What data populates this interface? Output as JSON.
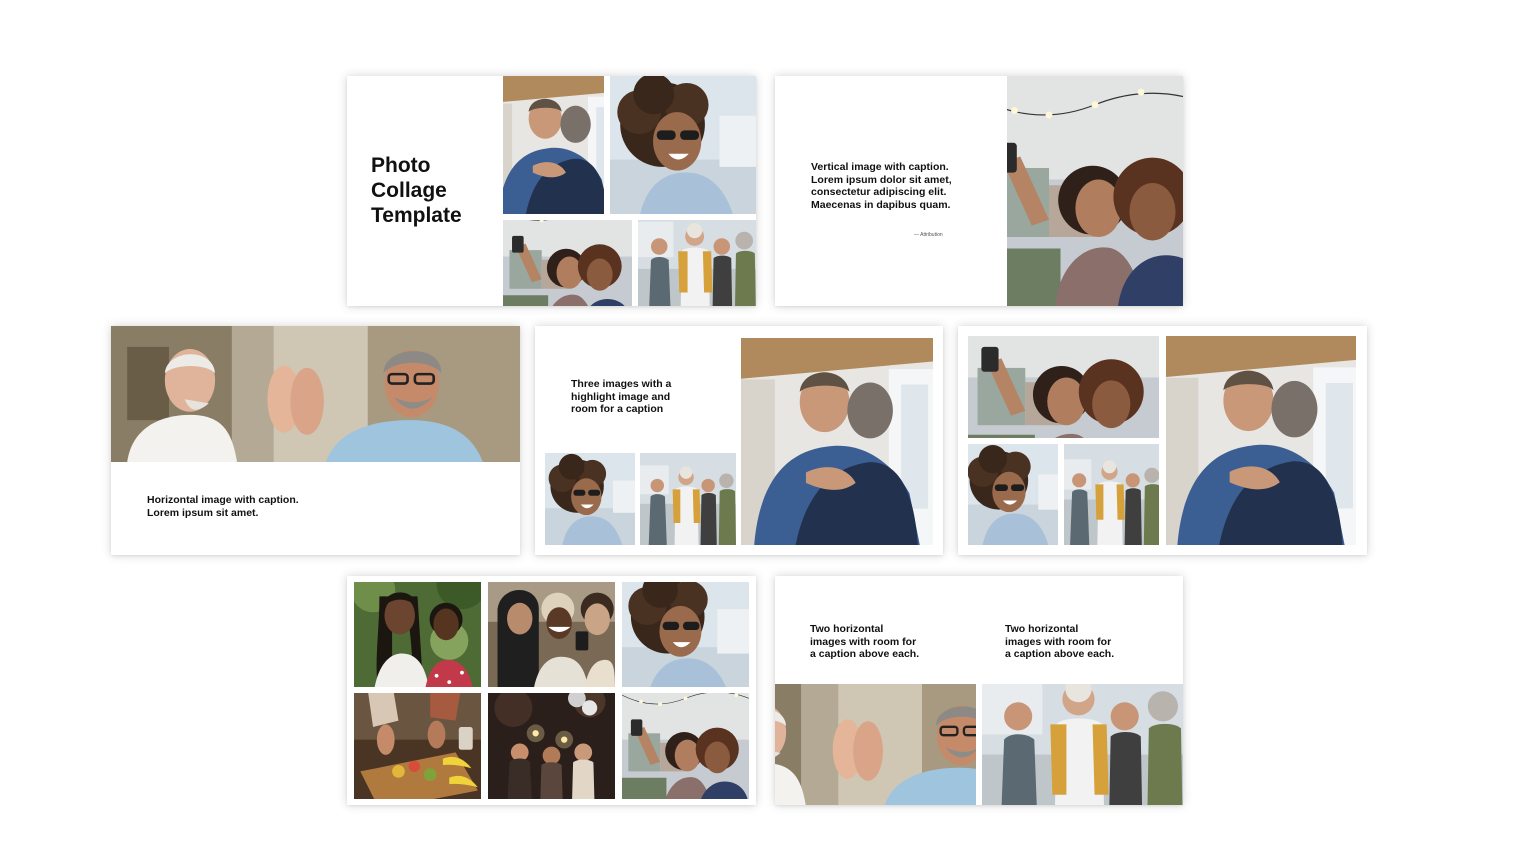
{
  "slides": {
    "s1": {
      "title": "Photo\nCollage\nTemplate"
    },
    "s2": {
      "caption": "Vertical image with caption.\nLorem ipsum dolor sit amet,\nconsectetur adipiscing elit.\nMaecenas in dapibus quam.",
      "attribution": "— Attribution"
    },
    "s3": {
      "caption": "Horizontal image with caption.\nLorem ipsum sit amet."
    },
    "s4": {
      "caption": "Three images with a\nhighlight image and\nroom for a caption"
    },
    "s7": {
      "caption_left": "Two horizontal\nimages with room for\na caption above each.",
      "caption_right": "Two horizontal\nimages with room for\na caption above each."
    }
  },
  "photo_subjects": {
    "hug": "two men hugging",
    "curly": "smiling woman with curly hair and sunglasses",
    "selfie": "two women taking a selfie on a rooftop",
    "group": "group of friends on a boardwalk",
    "highfive": "two older men high-fiving",
    "friends_two": "two women smiling outdoors",
    "phone_group": "three women looking at a phone",
    "cooking": "hands preparing food on a cutting board",
    "party": "people at an evening party with sparklers"
  },
  "colors": {
    "page_background": "#ffffff",
    "slide_background": "#ffffff",
    "text": "#111111"
  }
}
